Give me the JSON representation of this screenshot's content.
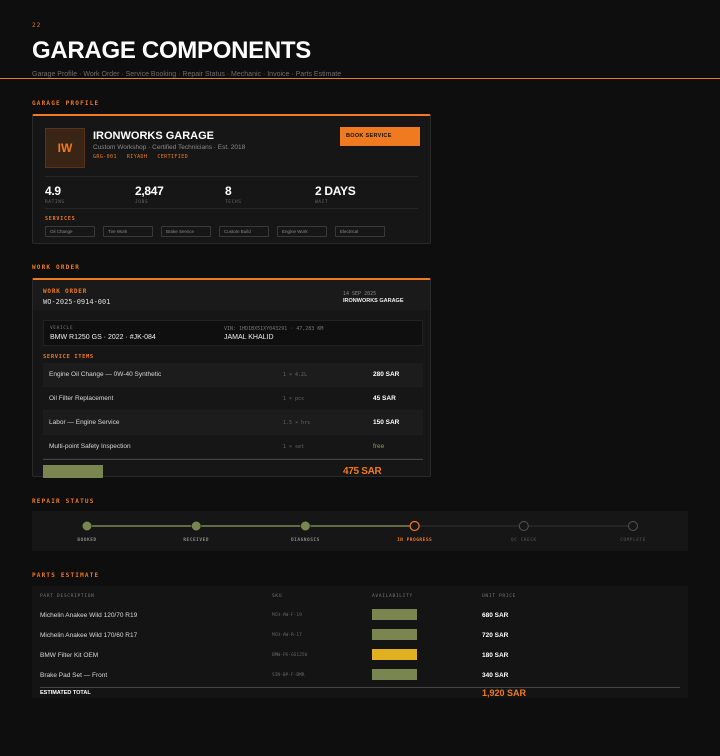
{
  "header": {
    "number": "22",
    "title": "GARAGE COMPONENTS",
    "subtitle": "Garage Profile · Work Order · Service Booking · Repair Status · Mechanic · Invoice · Parts Estimate"
  },
  "sections": {
    "profile": "GARAGE PROFILE",
    "work_order": "WORK ORDER",
    "repair_status": "REPAIR STATUS",
    "parts_estimate": "PARTS ESTIMATE"
  },
  "profile": {
    "logo": "IW",
    "name": "IRONWORKS GARAGE",
    "description": "Custom Workshop · Certified Technicians · Est. 2018",
    "tags": [
      "GRG-001",
      "RIYADH",
      "CERTIFIED"
    ],
    "book_button": "BOOK SERVICE",
    "stats": [
      {
        "value": "4.9",
        "label": "RATING"
      },
      {
        "value": "2,847",
        "label": "JOBS"
      },
      {
        "value": "8",
        "label": "TECHS"
      },
      {
        "value": "2 DAYS",
        "label": "WAIT"
      }
    ],
    "services_label": "SERVICES",
    "services": [
      "Oil Change",
      "Tire Work",
      "Brake Service",
      "Custom Build",
      "Engine Work",
      "Electrical"
    ]
  },
  "work_order": {
    "label": "WORK ORDER",
    "number": "WO-2025-0914-001",
    "date": "14 SEP 2025",
    "shop": "IRONWORKS GARAGE",
    "vehicle_label": "VEHICLE",
    "vehicle": "BMW R1250 GS · 2022 · #JK-084",
    "vin": "VIN: 1HD1BX51XY043291 · 47,283 KM",
    "owner": "JAMAL KHALID",
    "items_label": "SERVICE ITEMS",
    "items": [
      {
        "name": "Engine Oil Change — 0W-40 Synthetic",
        "qty": "1 × 4.2L",
        "price": "280 SAR"
      },
      {
        "name": "Oil Filter Replacement",
        "qty": "1 × pcs",
        "price": "45 SAR"
      },
      {
        "name": "Labor — Engine Service",
        "qty": "1.5 × hrs",
        "price": "150 SAR"
      },
      {
        "name": "Multi-point Safety Inspection",
        "qty": "1 × set",
        "price": "free"
      }
    ],
    "total": "475 SAR"
  },
  "repair_status": {
    "steps": [
      {
        "label": "BOOKED",
        "state": "done"
      },
      {
        "label": "RECEIVED",
        "state": "done"
      },
      {
        "label": "DIAGNOSIS",
        "state": "done"
      },
      {
        "label": "IN PROGRESS",
        "state": "current"
      },
      {
        "label": "QC CHECK",
        "state": "pending"
      },
      {
        "label": "COMPLETE",
        "state": "pending"
      }
    ]
  },
  "parts": {
    "headers": [
      "PART DESCRIPTION",
      "SKU",
      "AVAILABILITY",
      "UNIT PRICE"
    ],
    "rows": [
      {
        "name": "Michelin Anakee Wild 120/70 R19",
        "sku": "MCH-AW-F-19",
        "avail_color": "#7b8550",
        "price": "680 SAR"
      },
      {
        "name": "Michelin Anakee Wild 170/60 R17",
        "sku": "MCH-AW-R-17",
        "avail_color": "#7b8550",
        "price": "720 SAR"
      },
      {
        "name": "BMW Filter Kit OEM",
        "sku": "BMW-FK-GS1250",
        "avail_color": "#e0b020",
        "price": "180 SAR"
      },
      {
        "name": "Brake Pad Set — Front",
        "sku": "SIN-BP-F-BMR",
        "avail_color": "#7b8550",
        "price": "340 SAR"
      }
    ],
    "total_label": "ESTIMATED TOTAL",
    "total_value": "1,920 SAR"
  },
  "colors": {
    "accent": "#f07a1f",
    "done": "#7b8550",
    "pending": "#555555"
  }
}
